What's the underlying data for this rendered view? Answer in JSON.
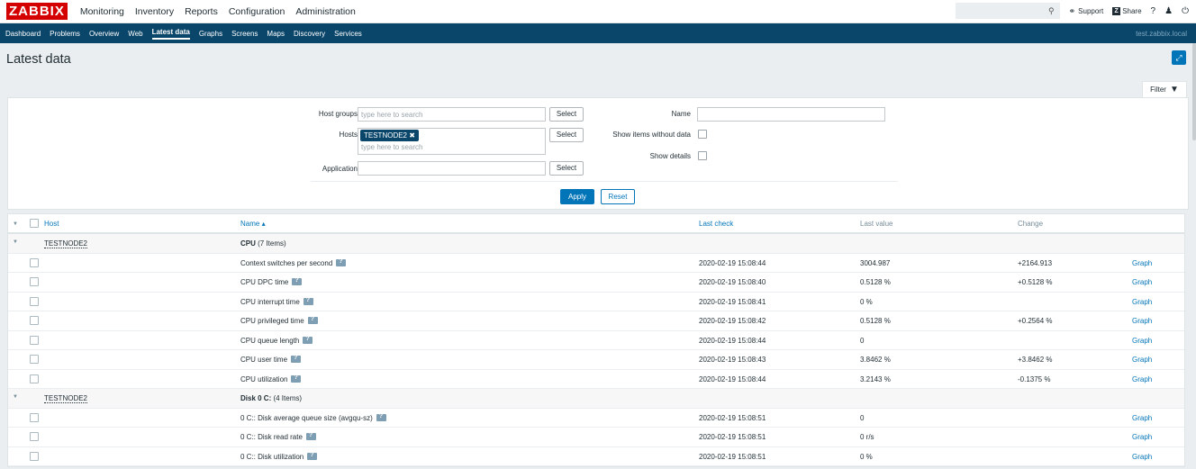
{
  "app": {
    "logo": "ZABBIX",
    "server_name": "test.zabbix.local"
  },
  "main_nav": [
    "Monitoring",
    "Inventory",
    "Reports",
    "Configuration",
    "Administration"
  ],
  "top_right": {
    "search_placeholder": "",
    "support": "Support",
    "share": "Share",
    "help": "?"
  },
  "sub_nav": [
    "Dashboard",
    "Problems",
    "Overview",
    "Web",
    "Latest data",
    "Graphs",
    "Screens",
    "Maps",
    "Discovery",
    "Services"
  ],
  "page": {
    "title": "Latest data"
  },
  "filter": {
    "tab_label": "Filter",
    "host_groups_label": "Host groups",
    "host_groups_placeholder": "type here to search",
    "hosts_label": "Hosts",
    "hosts_tag": "TESTNODE2",
    "hosts_placeholder": "type here to search",
    "application_label": "Application",
    "select_label": "Select",
    "name_label": "Name",
    "name_value": "",
    "show_items_without_data_label": "Show items without data",
    "show_details_label": "Show details",
    "apply_label": "Apply",
    "reset_label": "Reset"
  },
  "table": {
    "headers": {
      "host": "Host",
      "name": "Name ▴",
      "last_check": "Last check",
      "last_value": "Last value",
      "change": "Change"
    },
    "groups": [
      {
        "host": "TESTNODE2",
        "name": "CPU",
        "count": "(7 Items)",
        "items": [
          {
            "name": "Context switches per second",
            "last_check": "2020-02-19 15:08:44",
            "last_value": "3004.987",
            "change": "+2164.913",
            "link": "Graph"
          },
          {
            "name": "CPU DPC time",
            "last_check": "2020-02-19 15:08:40",
            "last_value": "0.5128 %",
            "change": "+0.5128 %",
            "link": "Graph"
          },
          {
            "name": "CPU interrupt time",
            "last_check": "2020-02-19 15:08:41",
            "last_value": "0 %",
            "change": "",
            "link": "Graph"
          },
          {
            "name": "CPU privileged time",
            "last_check": "2020-02-19 15:08:42",
            "last_value": "0.5128 %",
            "change": "+0.2564 %",
            "link": "Graph"
          },
          {
            "name": "CPU queue length",
            "last_check": "2020-02-19 15:08:44",
            "last_value": "0",
            "change": "",
            "link": "Graph"
          },
          {
            "name": "CPU user time",
            "last_check": "2020-02-19 15:08:43",
            "last_value": "3.8462 %",
            "change": "+3.8462 %",
            "link": "Graph"
          },
          {
            "name": "CPU utilization",
            "last_check": "2020-02-19 15:08:44",
            "last_value": "3.2143 %",
            "change": "-0.1375 %",
            "link": "Graph"
          }
        ]
      },
      {
        "host": "TESTNODE2",
        "name": "Disk 0 C:",
        "count": "(4 Items)",
        "items": [
          {
            "name": "0 C:: Disk average queue size (avgqu-sz)",
            "last_check": "2020-02-19 15:08:51",
            "last_value": "0",
            "change": "",
            "link": "Graph"
          },
          {
            "name": "0 C:: Disk read rate",
            "last_check": "2020-02-19 15:08:51",
            "last_value": "0 r/s",
            "change": "",
            "link": "Graph"
          },
          {
            "name": "0 C:: Disk utilization",
            "last_check": "2020-02-19 15:08:51",
            "last_value": "0 %",
            "change": "",
            "link": "Graph"
          }
        ]
      }
    ]
  }
}
